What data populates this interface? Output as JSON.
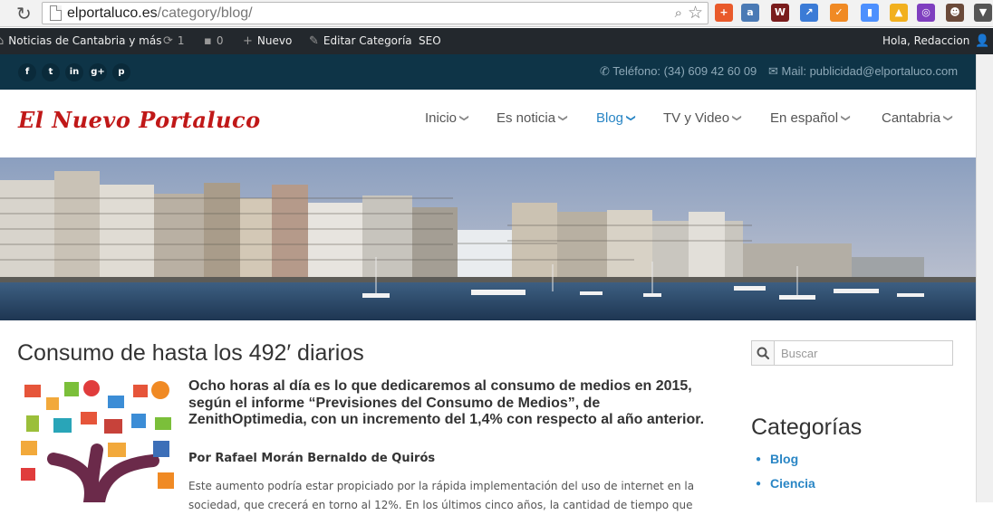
{
  "browser": {
    "url_domain": "elportaluco.es",
    "url_path": "/category/blog/",
    "extensions": [
      {
        "name": "plus-extension-icon",
        "color": "#e95a2b",
        "glyph": "+"
      },
      {
        "name": "profile-extension-icon",
        "color": "#4a7ab5",
        "glyph": "a"
      },
      {
        "name": "wr-extension-icon",
        "color": "#7a1c1c",
        "glyph": "W"
      },
      {
        "name": "chart-extension-icon",
        "color": "#3b7bd6",
        "glyph": "↗"
      },
      {
        "name": "fox-extension-icon",
        "color": "#f08a24",
        "glyph": "✓"
      },
      {
        "name": "analytics-extension-icon",
        "color": "#4d90fe",
        "glyph": "▮"
      },
      {
        "name": "bell-extension-icon",
        "color": "#f2b01e",
        "glyph": "▲"
      },
      {
        "name": "globe-extension-icon",
        "color": "#7f3fbf",
        "glyph": "◎"
      },
      {
        "name": "spy-extension-icon",
        "color": "#6b4a3a",
        "glyph": "☻"
      },
      {
        "name": "pocket-extension-icon",
        "color": "#555555",
        "glyph": "▼"
      }
    ]
  },
  "adminbar": {
    "site_name": "Noticias de Cantabria y más",
    "updates_count": "1",
    "comments_count": "0",
    "new_label": "Nuevo",
    "edit_label": "Editar Categoría",
    "seo_label": "SEO",
    "greeting": "Hola, Redaccion"
  },
  "topbar": {
    "social": [
      {
        "name": "facebook-icon",
        "glyph": "f"
      },
      {
        "name": "twitter-icon",
        "glyph": "t"
      },
      {
        "name": "linkedin-icon",
        "glyph": "in"
      },
      {
        "name": "googleplus-icon",
        "glyph": "g+"
      },
      {
        "name": "pinterest-icon",
        "glyph": "p"
      }
    ],
    "phone": "Teléfono: (34) 609 42 60 09",
    "mail": "Mail: publicidad@elportaluco.com"
  },
  "header": {
    "logo_text": "El Nuevo Portaluco",
    "nav": [
      {
        "label": "Inicio",
        "active": false
      },
      {
        "label": "Es noticia",
        "active": false
      },
      {
        "label": "Blog",
        "active": true
      },
      {
        "label": "TV y Video",
        "active": false
      },
      {
        "label": "En español",
        "active": false
      },
      {
        "label": "Cantabria",
        "active": false
      }
    ]
  },
  "post": {
    "title": "Consumo de hasta los 492′ diarios",
    "lead": "Ocho horas al día es lo que dedicaremos al consumo de medios en 2015, según el informe “Previsiones del Consumo de Medios”, de ZenithOptimedia, con un incremento del 1,4% con respecto al año anterior.",
    "byline": "Por Rafael Morán Bernaldo de Quirós",
    "excerpt": "Este aumento podría estar propiciado por la rápida implementación del uso de internet en la sociedad, que crecerá en torno al 12%. En los últimos cinco años, la cantidad de tiempo que"
  },
  "sidebar": {
    "search_placeholder": "Buscar",
    "categories_title": "Categorías",
    "categories": [
      "Blog",
      "Ciencia"
    ]
  },
  "colors": {
    "accent": "#2a86c5",
    "logo_red": "#c01818",
    "topbar_bg": "#0e3447",
    "adminbar_bg": "#23282d"
  }
}
